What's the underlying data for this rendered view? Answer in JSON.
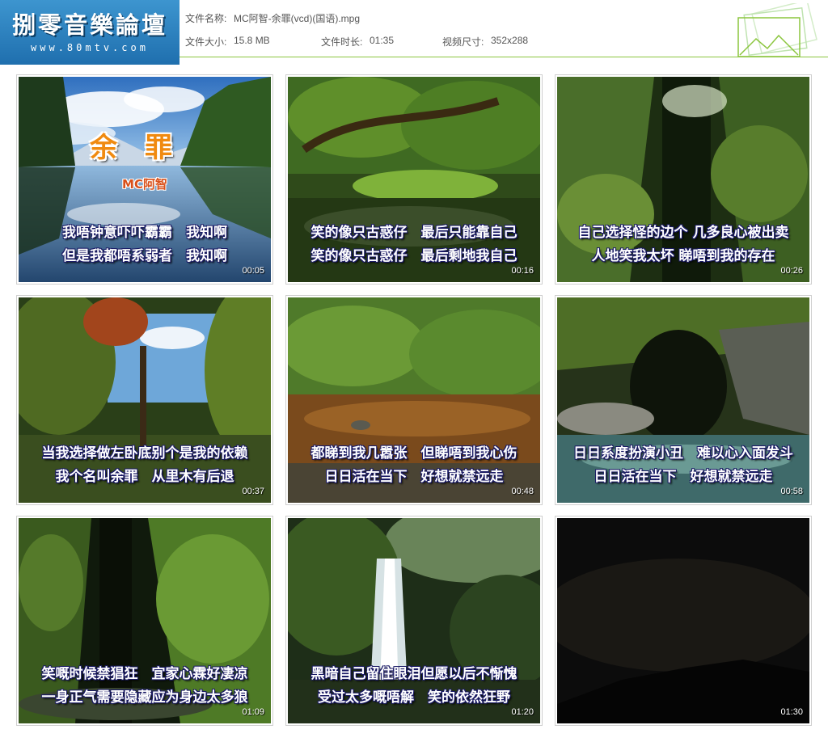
{
  "header": {
    "brand": "捌零音樂論壇",
    "site": "www.80mtv.com",
    "file_name_label": "文件名称:",
    "file_name": "MC阿智-余罪(vcd)(国语).mpg",
    "file_size_label": "文件大小:",
    "file_size": "15.8 MB",
    "duration_label": "文件时长:",
    "duration": "01:35",
    "video_size_label": "视频尺寸:",
    "video_size": "352x288"
  },
  "cover": {
    "title": "余罪",
    "artist": "MC阿智"
  },
  "thumbnails": [
    {
      "line1": "我唔钟意吓吓霸霸　我知啊",
      "line2": "但是我都唔系弱者　我知啊",
      "time": "00:05"
    },
    {
      "line1": "笑的像只古惑仔　最后只能靠自己",
      "line2": "笑的像只古惑仔　最后剩地我自己",
      "time": "00:16"
    },
    {
      "line1": "自己选择怪的边个 几多良心被出卖",
      "line2": "人地笑我太坏 睇唔到我的存在",
      "time": "00:26"
    },
    {
      "line1": "当我选择做左卧底别个是我的依赖",
      "line2": "我个名叫余罪　从里木有后退",
      "time": "00:37"
    },
    {
      "line1": "都睇到我几嚣张　但睇唔到我心伤",
      "line2": "日日活在当下　好想就禁远走",
      "time": "00:48"
    },
    {
      "line1": "日日系度扮演小丑　难以心入面发斗",
      "line2": "日日活在当下　好想就禁远走",
      "time": "00:58"
    },
    {
      "line1": "笑嘅时候禁猖狂　宜家心霖好凄凉",
      "line2": "一身正气需要隐藏应为身边太多狼",
      "time": "01:09"
    },
    {
      "line1": "黑暗自己留住眼泪但愿以后不惭愧",
      "line2": "受过太多嘅唔解　笑的依然狂野",
      "time": "01:20"
    },
    {
      "line1": "",
      "line2": "",
      "time": "01:30"
    }
  ]
}
